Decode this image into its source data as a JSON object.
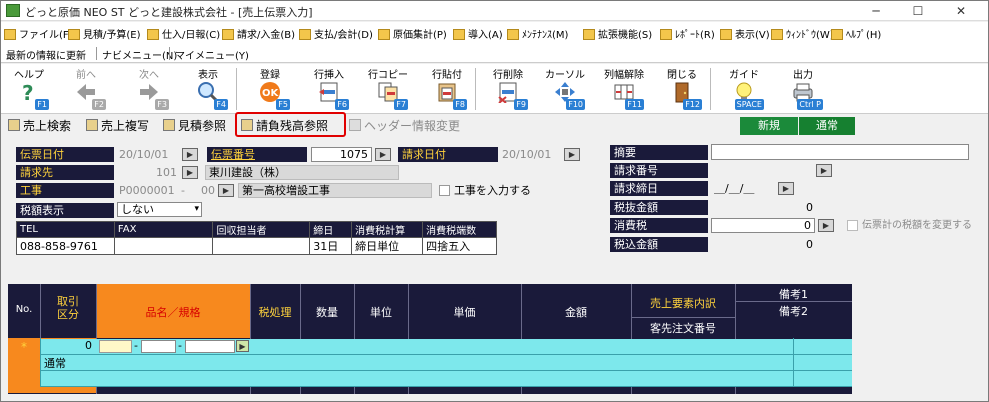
{
  "window": {
    "title": "どっと原価 NEO ST どっと建設株式会社 - [売上伝票入力]"
  },
  "menu": [
    {
      "label": "ファイル(F)"
    },
    {
      "label": "見積/予算(E)"
    },
    {
      "label": "仕入/日報(C)"
    },
    {
      "label": "請求/入金(B)"
    },
    {
      "label": "支払/会計(D)"
    },
    {
      "label": "原価集計(P)"
    },
    {
      "label": "導入(A)"
    },
    {
      "label": "ﾒﾝﾃﾅﾝｽ(M)"
    },
    {
      "label": "拡張機能(S)"
    },
    {
      "label": "ﾚﾎﾟｰﾄ(R)"
    },
    {
      "label": "表示(V)"
    },
    {
      "label": "ｳｨﾝﾄﾞｳ(W)"
    },
    {
      "label": "ﾍﾙﾌﾟ(H)"
    }
  ],
  "subbar": [
    "最新の情報に更新",
    "ナビメニュー(N)",
    "マイメニュー(Y)"
  ],
  "toolbar": [
    {
      "label": "ヘルプ",
      "key": "F1",
      "icon": "help-icon"
    },
    {
      "label": "前へ",
      "key": "F2",
      "icon": "back-arrow-icon"
    },
    {
      "label": "次へ",
      "key": "F3",
      "icon": "forward-arrow-icon"
    },
    {
      "label": "表示",
      "key": "F4",
      "icon": "magnifier-icon"
    },
    {
      "label": "登録",
      "key": "F5",
      "icon": "ok-icon"
    },
    {
      "label": "行挿入",
      "key": "F6",
      "icon": "insert-row-icon"
    },
    {
      "label": "行コピー",
      "key": "F7",
      "icon": "copy-row-icon"
    },
    {
      "label": "行貼付",
      "key": "F8",
      "icon": "paste-row-icon"
    },
    {
      "label": "行削除",
      "key": "F9",
      "icon": "delete-row-icon"
    },
    {
      "label": "カーソル",
      "key": "F10",
      "icon": "cursor-icon"
    },
    {
      "label": "列幅解除",
      "key": "F11",
      "icon": "column-width-icon"
    },
    {
      "label": "閉じる",
      "key": "F12",
      "icon": "door-icon"
    },
    {
      "label": "ガイド",
      "key": "SPACE",
      "icon": "bulb-icon"
    },
    {
      "label": "出力",
      "key": "Ctrl P",
      "icon": "output-icon"
    }
  ],
  "tabs": [
    "売上検索",
    "売上複写",
    "見積参照",
    "請負残高参照",
    "ヘッダー情報変更"
  ],
  "mode": {
    "new": "新規",
    "normal": "通常"
  },
  "form": {
    "slip_date_label": "伝票日付",
    "slip_date": "20/10/01",
    "slip_no_label": "伝票番号",
    "slip_no": "1075",
    "bill_date_label": "請求日付",
    "bill_date": "20/10/01",
    "customer_label": "請求先",
    "customer_code": "101",
    "customer_name": "東川建設（株）",
    "project_label": "工事",
    "project_code": "P0000001",
    "project_sub": "00",
    "project_name": "第一高校増設工事",
    "project_check_label": "工事を入力する",
    "tax_display_label": "税額表示",
    "tax_display": "しない"
  },
  "contact": {
    "headers": [
      "TEL",
      "FAX",
      "回収担当者",
      "締日",
      "消費税計算",
      "消費税端数"
    ],
    "values": [
      "088-858-9761",
      "",
      "",
      "31日",
      "締日単位",
      "四捨五入"
    ]
  },
  "summary": {
    "memo_label": "摘要",
    "invoice_no_label": "請求番号",
    "close_date_label": "請求締日",
    "close_date": "＿/＿/＿",
    "pretax_label": "税抜金額",
    "pretax": "0",
    "tax_label": "消費税",
    "tax": "0",
    "total_label": "税込金額",
    "total": "0",
    "tax_change_label": "伝票計の税額を変更する"
  },
  "grid": {
    "headers": [
      "No.",
      "取引\n区分",
      "品名／規格",
      "税処理",
      "数量",
      "単位",
      "単価",
      "金額",
      "売上要素内訳",
      "客先注文番号",
      "備考1",
      "備考2"
    ],
    "row": {
      "marker": "*",
      "kubun": "0",
      "kubun_name": "通常"
    }
  }
}
